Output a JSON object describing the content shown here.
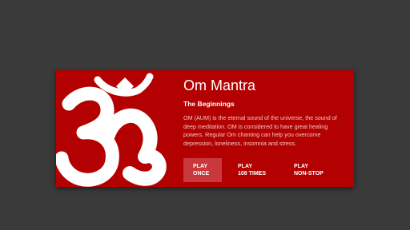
{
  "colors": {
    "background": "#3a3a3a",
    "card": "#b30000",
    "active_button": "#c9383b",
    "text": "#ffffff",
    "muted_text": "#f1c8c8"
  },
  "card": {
    "icon": "om-symbol-icon",
    "title": "Om Mantra",
    "subtitle": "The Beginnings",
    "description": "OM (AUM) is the eternal sound of the universe, the sound of deep meditation. OM is considered to have great healing powers. Regular Om chanting can help you overcome depression, loneliness, insomnia and stress."
  },
  "actions": [
    {
      "line1": "PLAY",
      "line2": "ONCE",
      "selected": true
    },
    {
      "line1": "PLAY",
      "line2": "108 TIMES",
      "selected": false
    },
    {
      "line1": "PLAY",
      "line2": "NON-STOP",
      "selected": false
    }
  ]
}
